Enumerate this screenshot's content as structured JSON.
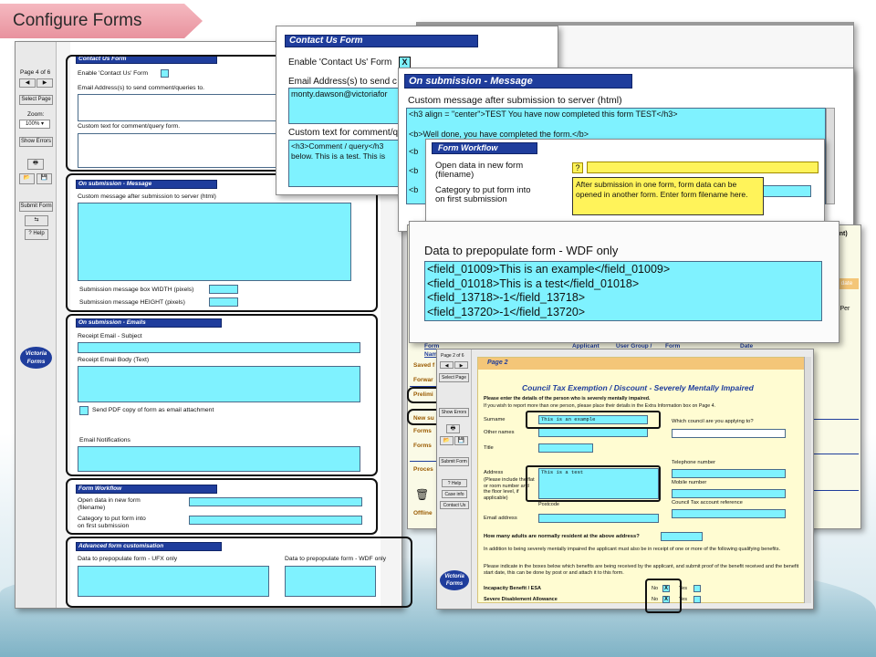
{
  "slide": {
    "title": "Configure Forms"
  },
  "left": {
    "page_of": "Page 4 of 6",
    "select_page": "Select Page",
    "zoom_label": "Zoom:",
    "zoom_value": "100%",
    "show_errors": "Show Errors",
    "submit_form": "Submit Form",
    "help": "Help",
    "logo_line1": "Victoria",
    "logo_line2": "Forms",
    "contact_hdr": "Contact Us Form",
    "enable_contact": "Enable 'Contact Us' Form",
    "email_addr": "Email Address(s) to send comment/queries to.",
    "custom_text": "Custom text for comment/query form.",
    "msg_hdr": "On submission - Message",
    "custom_msg": "Custom message after submission to server (html)",
    "box_width": "Submission message box WIDTH (pixels)",
    "box_height": "Submission message HEIGHT (pixels)",
    "emails_hdr": "On submission - Emails",
    "receipt_subject": "Receipt Email - Subject",
    "receipt_body": "Receipt Email Body (Text)",
    "send_pdf": "Send PDF copy of form as email attachment",
    "email_notifications": "Email Notifications",
    "workflow_hdr": "Form Workflow",
    "open_data": "Open data in new form",
    "filename": "(filename)",
    "category": "Category to put form into",
    "first_sub": "on first submission",
    "adv_hdr": "Advanced form customisation",
    "prepop_ufx": "Data to prepopulate form - UFX only",
    "prepop_wdf": "Data to prepopulate form - WDF only"
  },
  "contact": {
    "hdr": "Contact Us Form",
    "enable": "Enable 'Contact Us' Form",
    "x": "X",
    "email": "Email Address(s) to send c",
    "email_value": "monty.dawson@victoriafor",
    "custom": "Custom text for comment/q",
    "text_line1": "<h3>Comment / query</h3",
    "text_line2": "below. This is a test. This is"
  },
  "message": {
    "hdr": "On submission - Message",
    "label": "Custom message after submission to server (html)",
    "line1": "<h3 align = \"center\">TEST You have now completed this form TEST</h3>",
    "line2": "<b>Well done, you have completed the form.</b>",
    "b_tags": [
      "<b",
      "<b",
      "<b",
      "<b"
    ]
  },
  "workflow": {
    "hdr": "Form Workflow",
    "open_data": "Open data in new form",
    "filename": "(filename)",
    "category": "Category to put form into",
    "first_sub": "on first submission",
    "q": "?",
    "tooltip": "After submission in one form, form data can be opened in another form. Enter form filename here."
  },
  "prepop": {
    "title": "Data to prepopulate form - WDF only",
    "lines": [
      "<field_01009>This is an example</field_01009>",
      "<field_01018>This is a test</field_01018>",
      "<field_13718>-1</field_13718>",
      "<field_13720>-1</field_13720>"
    ]
  },
  "right_peek": {
    "ttl": "ttment)",
    "tab": "date",
    "per": "s Per"
  },
  "list": {
    "cols": [
      "Form",
      "Applicant",
      "User Group /",
      "Form",
      "Date"
    ],
    "nam": "Nam",
    "rows": [
      "Saved f",
      "Forwar",
      "Prelimi",
      "New su",
      "Forms",
      "Forms",
      "Proces",
      "Offline"
    ]
  },
  "council": {
    "page_of": "Page 2 of 6",
    "select_page": "Select Page",
    "show_errors": "Show Errors",
    "submit_form": "Submit Form",
    "help": "Help",
    "case_info": "Case info",
    "contact_us": "Contact Us",
    "logo1": "Victoria",
    "logo2": "Forms",
    "page_label": "Page 2",
    "title": "Council Tax Exemption / Discount - Severely Mentally Impaired",
    "intro1": "Please enter the details of the person who is severely mentally impaired.",
    "intro2": "If you wish to report more than one person, please place their details in the Extra Information box on Page 4.",
    "surname": "Surname",
    "surname_val": "This is an example",
    "other_names": "Other names",
    "title_field": "Title",
    "which_council": "Which council are you applying to?",
    "address": "Address",
    "address_note": "(Please include the flat or room number and the floor level, if applicable)",
    "address_val": "This is a test",
    "postcode": "Postcode",
    "telephone": "Telephone number",
    "mobile": "Mobile number",
    "account": "Council Tax account reference",
    "email": "Email address",
    "adults_q": "How many adults are normally resident at the above address?",
    "para1": "In addition to being severely mentally impaired the applicant must also be in receipt of one or more of the following qualifying benefits.",
    "para2": "Please indicate in the boxes below which benefits are being received by the applicant, and submit proof of the benefit received and the benefit start date, this can be done by post or                          and attach it to this form.",
    "benefit1": "Incapacity Benefit / ESA",
    "benefit2": "Severe Disablement Allowance",
    "no": "No",
    "yes": "Yes",
    "x": "X"
  }
}
